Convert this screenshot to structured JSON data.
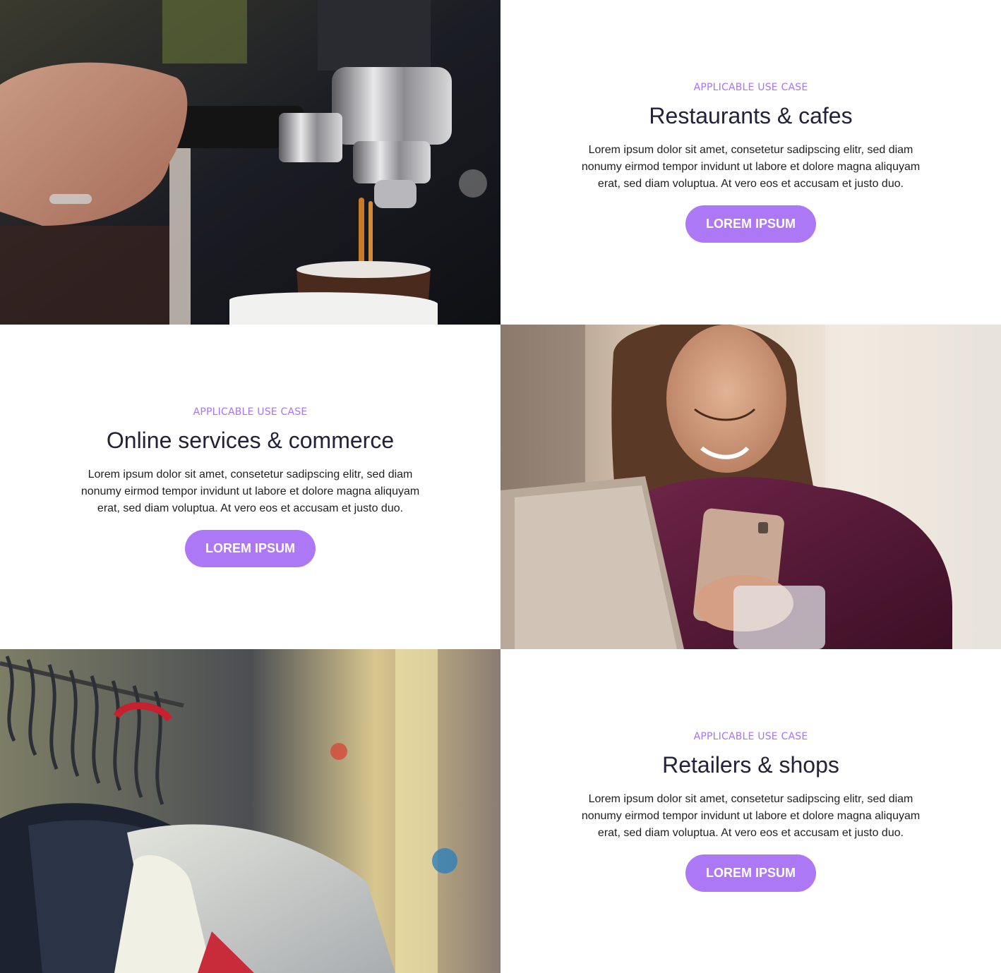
{
  "sections": [
    {
      "eyebrow": "APPLICABLE USE CASE",
      "title": "Restaurants & cafes",
      "body": "Lorem ipsum dolor sit amet, consetetur sadipscing elitr, sed diam nonumy eirmod tempor invidunt ut labore et dolore magna aliquyam erat, sed diam voluptua. At vero eos et accusam et justo duo.",
      "button": "LOREM IPSUM",
      "image": "espresso-machine-photo"
    },
    {
      "eyebrow": "APPLICABLE USE CASE",
      "title": "Online services & commerce",
      "body": "Lorem ipsum dolor sit amet, consetetur sadipscing elitr, sed diam nonumy eirmod tempor invidunt ut labore et dolore magna aliquyam erat, sed diam voluptua. At vero eos et accusam et justo duo.",
      "button": "LOREM IPSUM",
      "image": "woman-with-phone-photo"
    },
    {
      "eyebrow": "APPLICABLE USE CASE",
      "title": "Retailers & shops",
      "body": "Lorem ipsum dolor sit amet, consetetur sadipscing elitr, sed diam nonumy eirmod tempor invidunt ut labore et dolore magna aliquyam erat, sed diam voluptua. At vero eos et accusam et justo duo.",
      "button": "LOREM IPSUM",
      "image": "clothing-rack-photo"
    }
  ],
  "colors": {
    "accent": "#ad78f5",
    "eyebrow": "#a874ef",
    "title": "#23223a"
  }
}
